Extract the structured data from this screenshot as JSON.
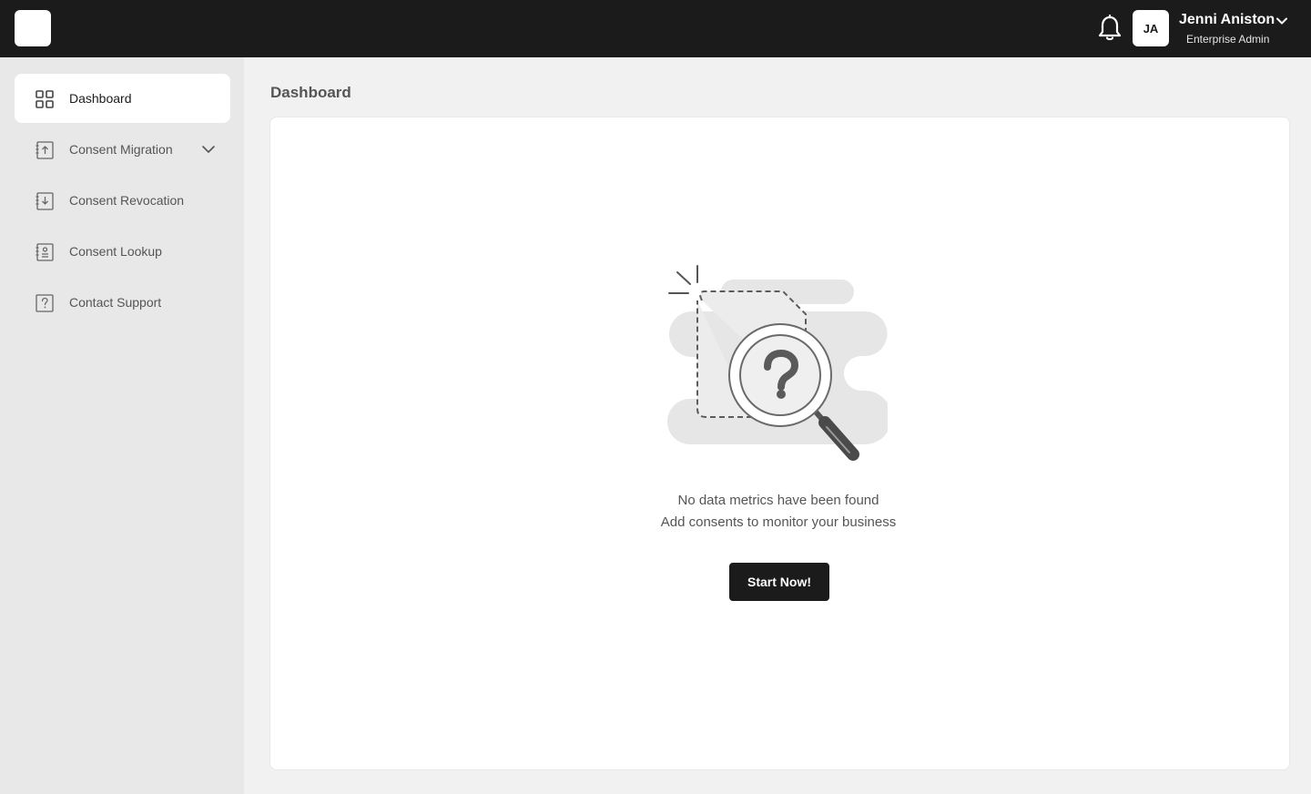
{
  "header": {
    "user": {
      "initials": "JA",
      "name": "Jenni Aniston",
      "role": "Enterprise Admin"
    },
    "icons": [
      "logo",
      "bell-icon",
      "chevron-down-icon"
    ]
  },
  "sidebar": {
    "items": [
      {
        "label": "Dashboard",
        "icon": "grid-icon",
        "active": true
      },
      {
        "label": "Consent Migration",
        "icon": "upload-doc-icon",
        "expandable": true
      },
      {
        "label": "Consent Revocation",
        "icon": "download-doc-icon"
      },
      {
        "label": "Consent Lookup",
        "icon": "lookup-doc-icon"
      },
      {
        "label": "Contact Support",
        "icon": "question-doc-icon"
      }
    ]
  },
  "main": {
    "title": "Dashboard",
    "empty_state": {
      "line1": "No data metrics have been found",
      "line2": "Add consents to monitor your business",
      "button_label": "Start Now!",
      "illustration": "magnifier-question-icon"
    }
  },
  "colors": {
    "topbar": "#1b1b1b",
    "sidebar": "#e8e8e8",
    "background": "#f1f1f1",
    "card": "#ffffff",
    "primary_button": "#1b1b1b"
  }
}
